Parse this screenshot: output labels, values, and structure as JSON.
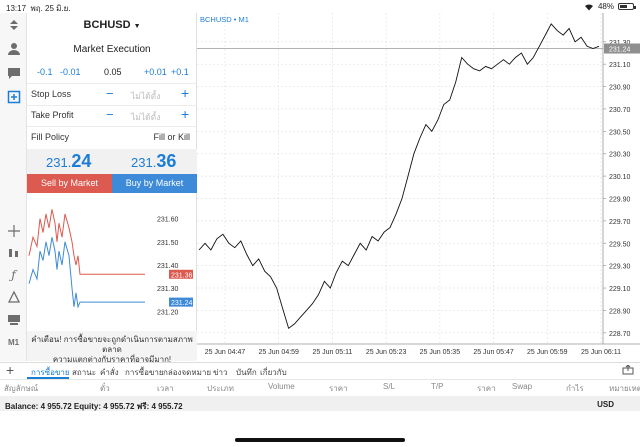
{
  "status": {
    "time": "13:17",
    "date": "พฤ. 25 มิ.ย.",
    "battery": "48%",
    "battery_fraction": 0.48
  },
  "order": {
    "symbol": "BCHUSD",
    "execution": "Market Execution",
    "volume_steps": [
      "-0.1",
      "-0.01",
      "0.05",
      "+0.01",
      "+0.1"
    ],
    "stop_loss_label": "Stop Loss",
    "take_profit_label": "Take Profit",
    "placeholder": "ไม่ได้ตั้ง",
    "fill_policy_label": "Fill Policy",
    "fill_policy_value": "Fill or Kill",
    "bid_prefix": "231.",
    "bid_big": "24",
    "ask_prefix": "231.",
    "ask_big": "36",
    "sell_label": "Sell by Market",
    "buy_label": "Buy by Market",
    "warning_line1": "คำเตือน! การซื้อขายจะถูกดำเนินการตามสภาพตลาด",
    "warning_line2": "ความแตกต่างกับราคาที่อาจมีมาก!"
  },
  "mini_chart": {
    "ticks": [
      "231.60",
      "231.50",
      "231.40",
      "231.30",
      "231.20"
    ],
    "bid_tag": "231.24",
    "ask_tag": "231.36",
    "ylim": [
      231.15,
      231.65
    ]
  },
  "chart_data": {
    "type": "line",
    "title": "BCHUSD • M1",
    "ylim": [
      228.6,
      231.45
    ],
    "yticks": [
      "231.30",
      "231.10",
      "230.90",
      "230.70",
      "230.50",
      "230.30",
      "230.10",
      "229.90",
      "229.70",
      "229.50",
      "229.30",
      "229.10",
      "228.90",
      "228.70"
    ],
    "xticks": [
      "25 Jun 04:47",
      "25 Jun 04:59",
      "25 Jun 05:11",
      "25 Jun 05:23",
      "25 Jun 05:35",
      "25 Jun 05:47",
      "25 Jun 05:59",
      "25 Jun 06:11"
    ],
    "current_price_tag": "231.24",
    "current_price": 231.24,
    "values": [
      229.44,
      229.5,
      229.44,
      229.54,
      229.58,
      229.5,
      229.46,
      229.52,
      229.4,
      229.3,
      229.36,
      229.25,
      229.2,
      229.1,
      228.92,
      228.74,
      228.78,
      228.84,
      228.9,
      228.96,
      229.04,
      229.16,
      229.1,
      229.24,
      229.34,
      229.3,
      229.4,
      229.5,
      229.44,
      229.56,
      229.52,
      229.6,
      229.64,
      229.76,
      229.9,
      230.1,
      230.3,
      230.44,
      230.56,
      230.5,
      230.6,
      230.74,
      230.78,
      230.94,
      231.16,
      231.1,
      231.06,
      231.04,
      231.08,
      231.06,
      231.1,
      231.14,
      231.1,
      231.16,
      231.2,
      231.1,
      231.16,
      231.26,
      231.36,
      231.46,
      231.4,
      231.36,
      231.42,
      231.3,
      231.34,
      231.26,
      231.24,
      231.26
    ]
  },
  "tabs": {
    "items": [
      "การซื้อขาย",
      "สถานะ",
      "คำสั่ง",
      "การซื้อขาย",
      "กล่องจดหมาย",
      "ข่าว",
      "บันทึก",
      "เกี่ยวกับ"
    ]
  },
  "table_headers": [
    "สัญลักษณ์",
    "ตั๋ว",
    "เวลา",
    "ประเภท",
    "Volume",
    "ราคา",
    "S/L",
    "T/P",
    "ราคา",
    "Swap",
    "กำไร",
    "หมายเหตุ"
  ],
  "account": {
    "balance_line": "Balance: 4 955.72 Equity: 4 955.72 ฟรี: 4 955.72",
    "currency": "USD"
  },
  "colors": {
    "accent": "#1c7dd6",
    "sell": "#dc5a50",
    "buy": "#3c8ad8",
    "bid_line": "#dc5a50",
    "ask_line": "#3c8ad8"
  }
}
